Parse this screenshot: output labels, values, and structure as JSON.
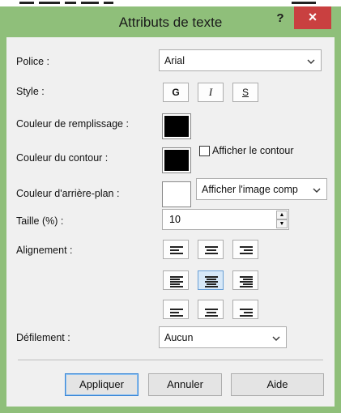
{
  "window": {
    "title": "Attributs de texte",
    "help_label": "?",
    "close_label": "×"
  },
  "form": {
    "police": {
      "label": "Police :",
      "value": "Arial"
    },
    "style": {
      "label": "Style :",
      "bold": "G",
      "italic": "I",
      "strike": "S"
    },
    "fill_color": {
      "label": "Couleur de remplissage :",
      "color": "#000000"
    },
    "outline_color": {
      "label": "Couleur du contour :",
      "color": "#000000",
      "checkbox_label": "Afficher le contour",
      "checked": false
    },
    "background_color": {
      "label": "Couleur d'arrière-plan :",
      "color": "#ffffff",
      "mode_value": "Afficher l'image comp"
    },
    "size": {
      "label": "Taille (%) :",
      "value": "10"
    },
    "alignment": {
      "label": "Alignement :",
      "selected_row": 2,
      "selected_col": 2
    },
    "scroll": {
      "label": "Défilement :",
      "value": "Aucun"
    }
  },
  "buttons": {
    "apply": "Appliquer",
    "cancel": "Annuler",
    "help": "Aide"
  }
}
